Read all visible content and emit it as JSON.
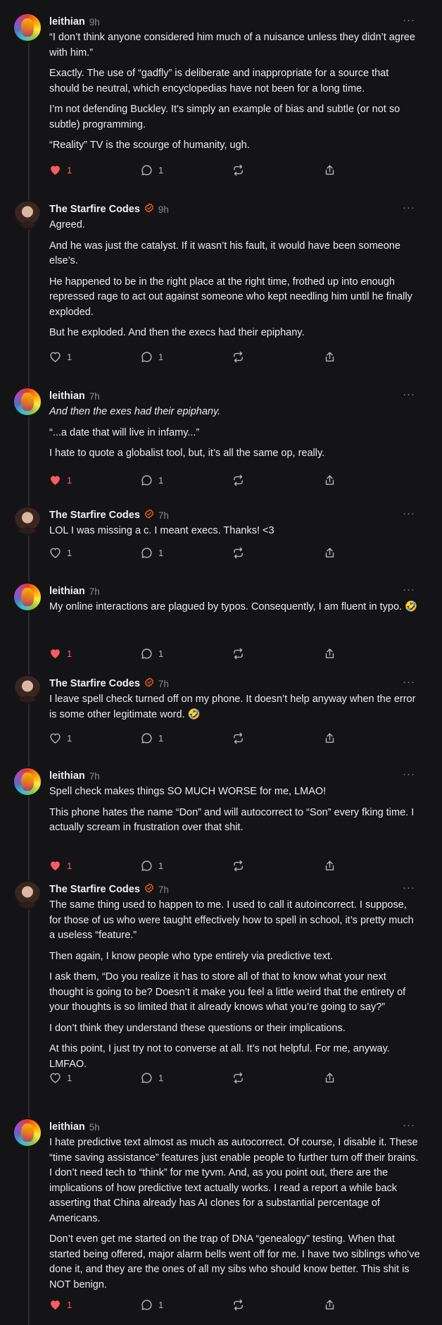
{
  "comments": [
    {
      "author": "leithian",
      "time": "9h",
      "avatar": "leithian-avatar",
      "verified": false,
      "paragraphs": [
        {
          "text": "“I don’t think anyone considered him much of a nuisance unless they didn’t agree with him.”",
          "italic": false
        },
        {
          "text": "Exactly. The use of “gadfly” is deliberate and inappropriate for a source that should be neutral, which encyclopedias have not been for a long time.",
          "italic": false
        },
        {
          "text": "I’m not defending Buckley. It's simply an example of bias and subtle (or not so subtle) programming.",
          "italic": false
        },
        {
          "text": "“Reality” TV is the scourge of humanity, ugh.",
          "italic": false
        }
      ],
      "likes": "1",
      "liked": true,
      "replies": "1"
    },
    {
      "author": "The Starfire Codes",
      "time": "9h",
      "avatar": "starfire-avatar",
      "verified": true,
      "paragraphs": [
        {
          "text": "Agreed.",
          "italic": false
        },
        {
          "text": "And he was just the catalyst. If it wasn’t his fault, it would have been someone else’s.",
          "italic": false
        },
        {
          "text": "He happened to be in the right place at the right time, frothed up into enough repressed rage to act out against someone who kept needling him until he finally exploded.",
          "italic": false
        },
        {
          "text": "But he exploded. And then the execs had their epiphany.",
          "italic": false
        }
      ],
      "likes": "1",
      "liked": false,
      "replies": "1"
    },
    {
      "author": "leithian",
      "time": "7h",
      "avatar": "leithian-avatar",
      "verified": false,
      "paragraphs": [
        {
          "text": "And then the exes had their epiphany.",
          "italic": true
        },
        {
          "text": "“...a date that will live in infamy...”",
          "italic": false
        },
        {
          "text": "I hate to quote a globalist tool, but, it’s all the same op, really.",
          "italic": false
        }
      ],
      "likes": "1",
      "liked": true,
      "replies": "1"
    },
    {
      "author": "The Starfire Codes",
      "time": "7h",
      "avatar": "starfire-avatar",
      "verified": true,
      "paragraphs": [
        {
          "text": "LOL I was missing a c. I meant execs. Thanks! <3",
          "italic": false
        }
      ],
      "likes": "1",
      "liked": false,
      "replies": "1"
    },
    {
      "author": "leithian",
      "time": "7h",
      "avatar": "leithian-avatar",
      "verified": false,
      "paragraphs": [
        {
          "text": "My online interactions are plagued by typos. Consequently, I am fluent in typo. 🤣",
          "italic": false
        }
      ],
      "likes": "1",
      "liked": true,
      "replies": "1"
    },
    {
      "author": "The Starfire Codes",
      "time": "7h",
      "avatar": "starfire-avatar",
      "verified": true,
      "paragraphs": [
        {
          "text": "I leave spell check turned off on my phone. It doesn’t help anyway when the error is some other legitimate word. 🤣",
          "italic": false
        }
      ],
      "likes": "1",
      "liked": false,
      "replies": "1"
    },
    {
      "author": "leithian",
      "time": "7h",
      "avatar": "leithian-avatar",
      "verified": false,
      "paragraphs": [
        {
          "text": "Spell check makes things SO MUCH WORSE for me, LMAO!",
          "italic": false
        },
        {
          "text": "This phone hates the name “Don” and will autocorrect to “Son” every fking time. I actually scream in frustration over that shit.",
          "italic": false
        }
      ],
      "likes": "1",
      "liked": true,
      "replies": "1"
    },
    {
      "author": "The Starfire Codes",
      "time": "7h",
      "avatar": "starfire-avatar",
      "verified": true,
      "paragraphs": [
        {
          "text": "The same thing used to happen to me. I used to call it autoincorrect. I suppose, for those of us who were taught effectively how to spell in school, it’s pretty much a useless “feature.”",
          "italic": false
        },
        {
          "text": "Then again, I know people who type entirely via predictive text.",
          "italic": false
        },
        {
          "text": "I ask them, “Do you realize it has to store all of that to know what your next thought is going to be? Doesn’t it make you feel a little weird that the entirety of your thoughts is so limited that it already knows what you’re going to say?”",
          "italic": false
        },
        {
          "text": "I don’t think they understand these questions or their implications.",
          "italic": false
        },
        {
          "text": "At this point, I just try not to converse at all. It’s not helpful. For me, anyway. LMFAO.",
          "italic": false
        }
      ],
      "likes": "1",
      "liked": false,
      "replies": "1"
    },
    {
      "author": "leithian",
      "time": "5h",
      "avatar": "leithian-avatar",
      "verified": false,
      "paragraphs": [
        {
          "text": "I hate predictive text almost as much as autocorrect. Of course, I disable it. These “time saving assistance” features just enable people to further turn off their brains. I don’t need tech to “think” for me tyvm. And, as you point out, there are the implications of how predictive text actually works. I read a report a while back asserting that China already has AI clones for a substantial percentage of Americans.",
          "italic": false
        },
        {
          "text": "Don’t even get me started on the trap of DNA “genealogy” testing. When that started being offered, major alarm bells went off for me. I have two siblings who’ve done it, and they are the ones of all my sibs who should know better. This shit is NOT benign.",
          "italic": false
        }
      ],
      "likes": "1",
      "liked": true,
      "replies": "1"
    }
  ],
  "colors": {
    "liked": "#ff5a5f",
    "verified": "#ff6719",
    "muted": "#8a8a90"
  },
  "icons": {
    "like": "heart-icon",
    "reply": "reply-bubble-icon",
    "restack": "restack-icon",
    "share": "share-icon",
    "more": "more-options-icon",
    "verified": "verified-badge-icon"
  }
}
